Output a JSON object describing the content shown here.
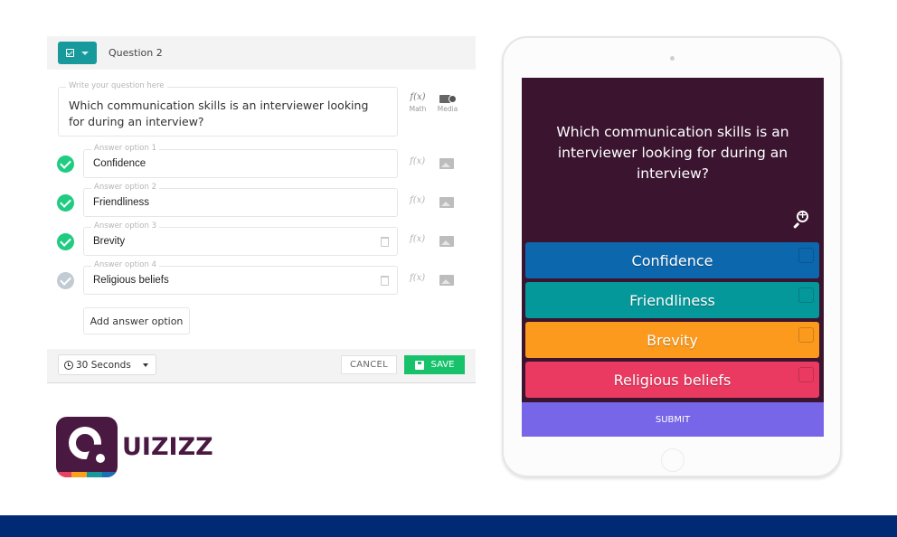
{
  "editor": {
    "question_label": "Question 2",
    "question_field": {
      "legend": "Write your question here",
      "value": "Which communication skills is an interviewer looking for during an interview?"
    },
    "tools": {
      "math_label": "Math",
      "math_glyph": "f(x)",
      "media_label": "Media"
    },
    "options": [
      {
        "legend": "Answer option 1",
        "value": "Confidence",
        "correct": true,
        "deletable": false
      },
      {
        "legend": "Answer option 2",
        "value": "Friendliness",
        "correct": true,
        "deletable": false
      },
      {
        "legend": "Answer option 3",
        "value": "Brevity",
        "correct": true,
        "deletable": true
      },
      {
        "legend": "Answer option 4",
        "value": "Religious beliefs",
        "correct": false,
        "deletable": true
      }
    ],
    "option_fx_glyph": "f(x)",
    "add_option_label": "Add answer option",
    "timer_value": "30 Seconds",
    "cancel_label": "CANCEL",
    "save_label": "SAVE"
  },
  "logo": {
    "text": "UIZIZZ",
    "stripe_colors": [
      "#e8435f",
      "#f9a11b",
      "#18999b",
      "#1d6fb7"
    ]
  },
  "preview": {
    "question": "Which communication skills is an interviewer looking for during an interview?",
    "answers": [
      {
        "label": "Confidence",
        "color": "#0d67ad"
      },
      {
        "label": "Friendliness",
        "color": "#05989a"
      },
      {
        "label": "Brevity",
        "color": "#fb9a1d"
      },
      {
        "label": "Religious beliefs",
        "color": "#ea3a62"
      }
    ],
    "submit_label": "SUBMIT"
  },
  "colors": {
    "teal": "#18999b",
    "green": "#17c26b",
    "plum": "#3b1530",
    "submit": "#7766e8",
    "navy_bar": "#002b74"
  }
}
